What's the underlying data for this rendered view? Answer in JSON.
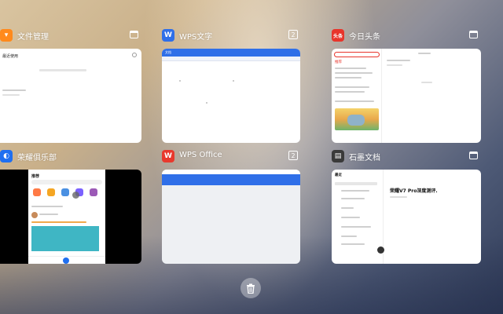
{
  "cards": [
    {
      "app_name": "文件管理",
      "icon_color": "#ff8a1c",
      "icon_glyph": "▾",
      "badge": ""
    },
    {
      "app_name": "WPS文字",
      "icon_color": "#2f6fe8",
      "icon_glyph": "W",
      "badge": "2"
    },
    {
      "app_name": "今日头条",
      "icon_color": "#e8352b",
      "icon_glyph": "头条",
      "badge": ""
    },
    {
      "app_name": "荣耀俱乐部",
      "icon_color": "#1f6ff0",
      "icon_glyph": "◐",
      "badge": ""
    },
    {
      "app_name": "WPS Office",
      "icon_color": "#e8392d",
      "icon_glyph": "W",
      "badge": "2"
    },
    {
      "app_name": "石墨文档",
      "icon_color": "#3a3a3a",
      "icon_glyph": "▤",
      "badge": ""
    }
  ],
  "thumbs": {
    "files_title": "最近使用",
    "wps_title": "文档",
    "toutiao_tab": "推荐",
    "club_tab": "推荐",
    "shimo_heading": "荣耀V7 Pro深度测评.",
    "shimo_tab": "最近"
  },
  "colors": {
    "wps_blue": "#2f6fe8",
    "toutiao_red": "#e8352b",
    "club_teal": "#3fb6c4"
  }
}
